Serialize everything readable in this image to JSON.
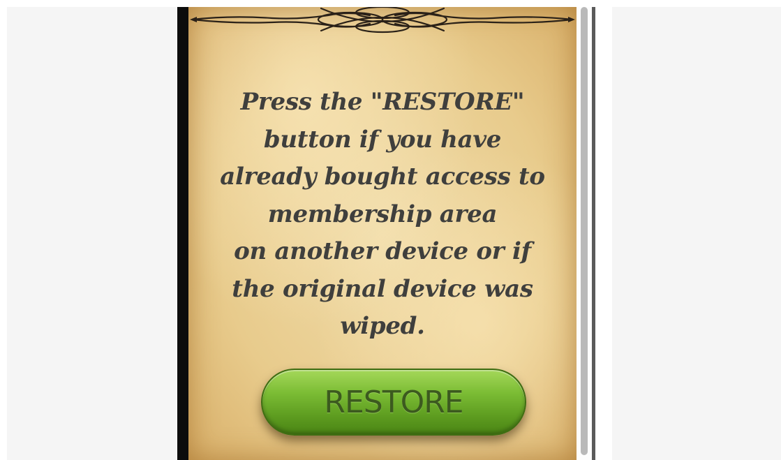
{
  "message": {
    "text": "Press the \"RESTORE\"\nbutton if you have\nalready bought access to\nmembership area\non another device or if\nthe original device was\nwiped."
  },
  "restore_button": {
    "label": "RESTORE"
  },
  "colors": {
    "paper": "#e8cb8c",
    "text": "#3f3f3d",
    "button_green": "#7cbd35",
    "button_text": "#3c5a1f",
    "frame": "#0c0c0c",
    "scrollbar_thumb": "#b9b9b9"
  },
  "icons": {
    "ornament": "decorative-scroll-divider-icon"
  }
}
